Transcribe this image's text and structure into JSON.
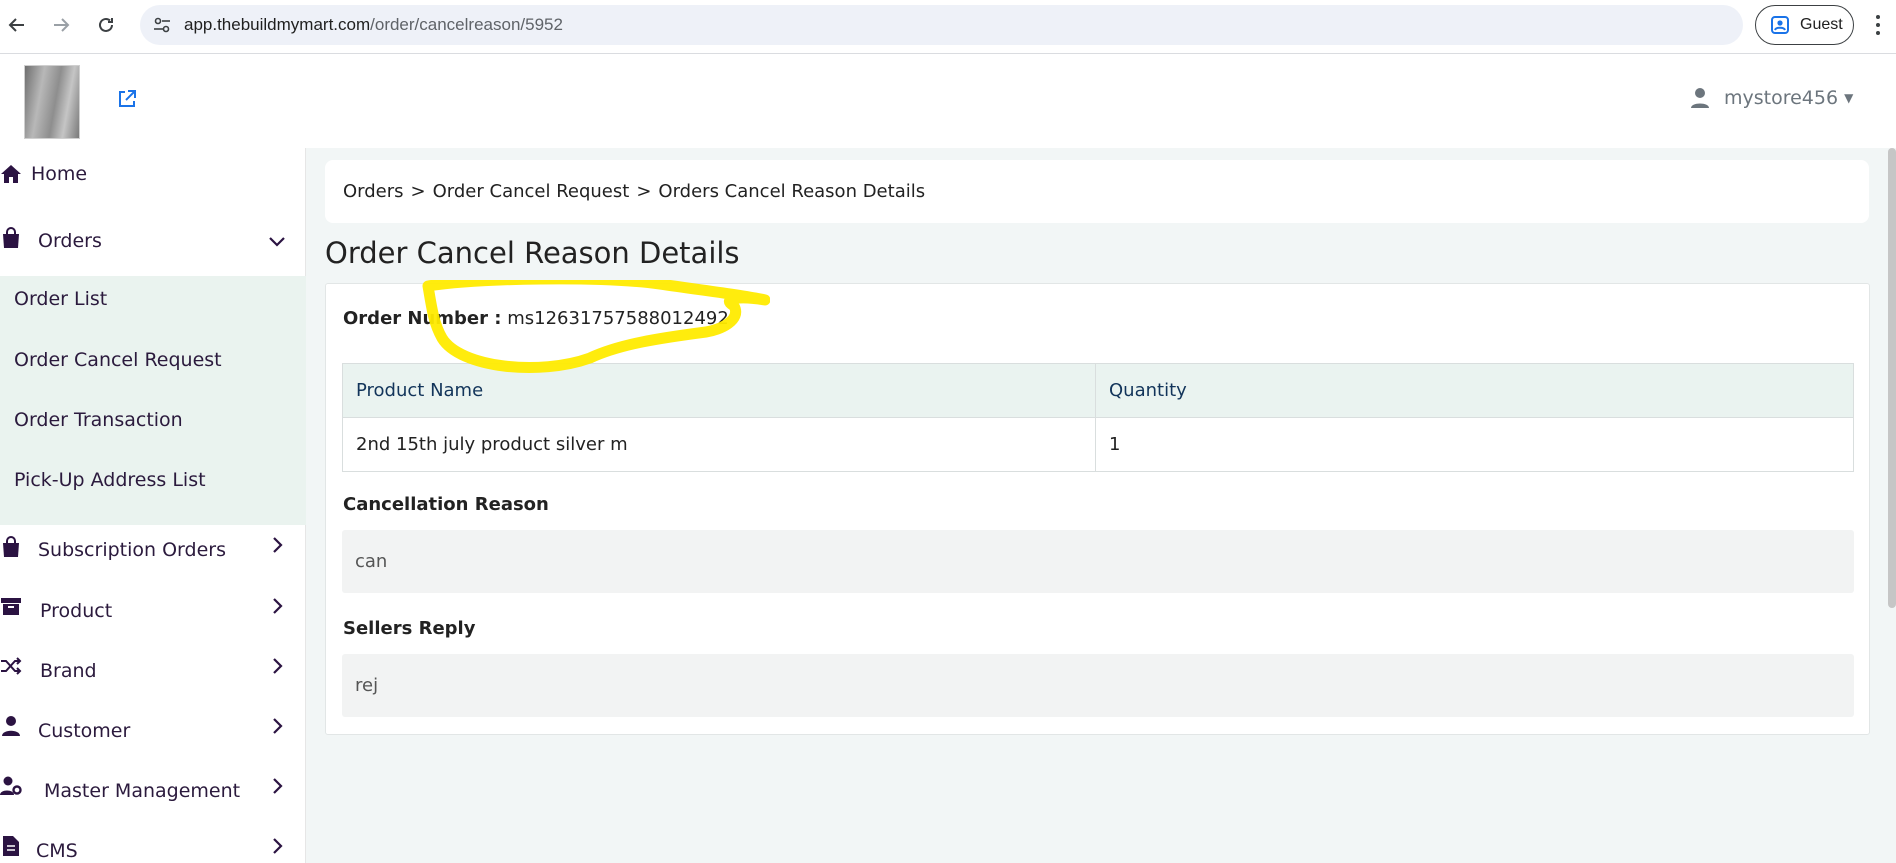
{
  "browser": {
    "url_host": "app.thebuildmymart.com",
    "url_path": "/order/cancelreason/5952",
    "profile_label": "Guest"
  },
  "header": {
    "username": "mystore456"
  },
  "sidebar": {
    "items": [
      {
        "label": "Home",
        "icon": "home-icon"
      },
      {
        "label": "Orders",
        "icon": "shopping-bag-icon",
        "expanded": true
      },
      {
        "label": "Subscription Orders",
        "icon": "shopping-bag-icon"
      },
      {
        "label": "Product",
        "icon": "archive-box-icon"
      },
      {
        "label": "Brand",
        "icon": "shuffle-icon"
      },
      {
        "label": "Customer",
        "icon": "user-icon"
      },
      {
        "label": "Master Management",
        "icon": "user-gear-icon"
      },
      {
        "label": "CMS",
        "icon": "file-icon"
      }
    ],
    "orders_submenu": [
      "Order List",
      "Order Cancel Request",
      "Order Transaction",
      "Pick-Up Address List"
    ]
  },
  "breadcrumb": [
    "Orders",
    "Order Cancel Request",
    "Orders Cancel Reason Details"
  ],
  "breadcrumb_sep": ">",
  "page": {
    "title": "Order Cancel Reason Details",
    "order_number_label": "Order Number :",
    "order_number_value": "ms12631757588012492"
  },
  "table": {
    "headers": [
      "Product Name",
      "Quantity"
    ],
    "rows": [
      [
        "2nd 15th july product silver m",
        "1"
      ]
    ]
  },
  "cancellation": {
    "label": "Cancellation Reason",
    "value": "can"
  },
  "seller_reply": {
    "label": "Sellers Reply",
    "value": "rej"
  },
  "colors": {
    "accent_link": "#1a73e8",
    "sidebar_text": "#2b1a3d",
    "submenu_bg": "#eaf3ef",
    "highlight": "#ffeb00"
  }
}
